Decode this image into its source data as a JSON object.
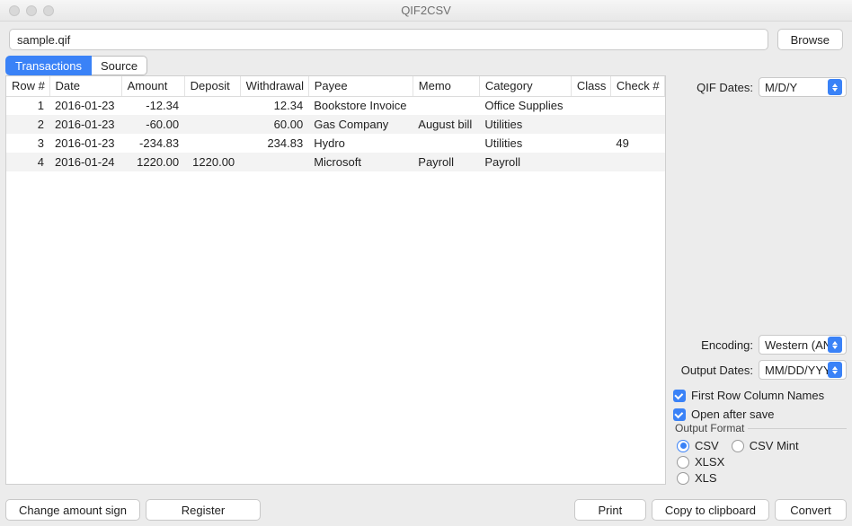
{
  "window": {
    "title": "QIF2CSV"
  },
  "top": {
    "file_value": "sample.qif",
    "browse_label": "Browse"
  },
  "tabs": {
    "transactions": "Transactions",
    "source": "Source"
  },
  "table": {
    "headers": [
      "Row #",
      "Date",
      "Amount",
      "Deposit",
      "Withdrawal",
      "Payee",
      "Memo",
      "Category",
      "Class",
      "Check #"
    ],
    "rows": [
      {
        "row": "1",
        "date": "2016-01-23",
        "amount": "-12.34",
        "deposit": "",
        "withdrawal": "12.34",
        "payee": "Bookstore Invoice",
        "memo": "",
        "category": "Office Supplies",
        "class": "",
        "check": ""
      },
      {
        "row": "2",
        "date": "2016-01-23",
        "amount": "-60.00",
        "deposit": "",
        "withdrawal": "60.00",
        "payee": "Gas Company",
        "memo": "August bill",
        "category": "Utilities",
        "class": "",
        "check": ""
      },
      {
        "row": "3",
        "date": "2016-01-23",
        "amount": "-234.83",
        "deposit": "",
        "withdrawal": "234.83",
        "payee": "Hydro",
        "memo": "",
        "category": "Utilities",
        "class": "",
        "check": "49"
      },
      {
        "row": "4",
        "date": "2016-01-24",
        "amount": "1220.00",
        "deposit": "1220.00",
        "withdrawal": "",
        "payee": "Microsoft",
        "memo": "Payroll",
        "category": "Payroll",
        "class": "",
        "check": ""
      }
    ]
  },
  "side": {
    "qif_dates_label": "QIF Dates:",
    "qif_dates_value": "M/D/Y",
    "encoding_label": "Encoding:",
    "encoding_value": "Western (ANS",
    "output_dates_label": "Output Dates:",
    "output_dates_value": "MM/DD/YYYY",
    "first_row_label": "First Row Column Names",
    "open_after_label": "Open after save",
    "group_title": "Output Format",
    "fmt_csv": "CSV",
    "fmt_csv_mint": "CSV Mint",
    "fmt_xlsx": "XLSX",
    "fmt_xls": "XLS"
  },
  "bottom": {
    "change_sign": "Change amount sign",
    "register": "Register",
    "print": "Print",
    "copy": "Copy to clipboard",
    "convert": "Convert"
  }
}
